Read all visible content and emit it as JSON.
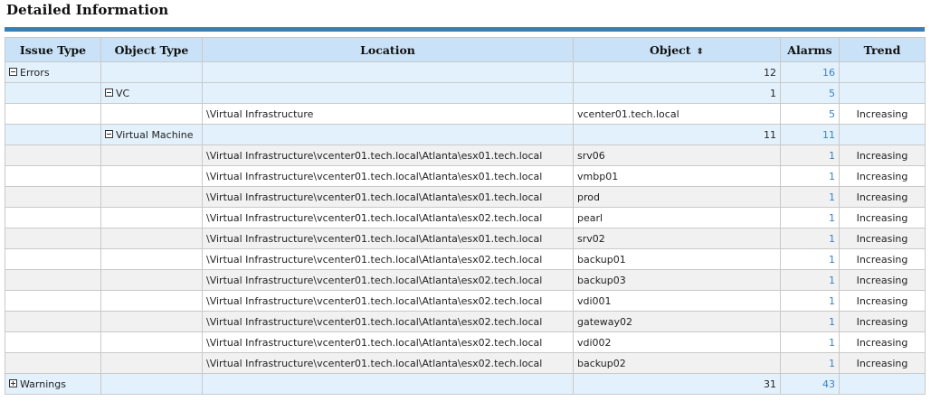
{
  "page_title": "Detailed Information",
  "columns": {
    "issue_type": "Issue Type",
    "object_type": "Object Type",
    "location": "Location",
    "object": "Object",
    "alarms": "Alarms",
    "trend": "Trend"
  },
  "sort_icon": "sort-up-down-icon",
  "colors": {
    "header_bg": "#c9e2f7",
    "group_bg": "#e3f1fc",
    "accent_bar": "#3a7fb0",
    "link": "#3a7fc8"
  },
  "errors_group": {
    "label": "Errors",
    "count": "12",
    "alarms": "16",
    "expanded": true
  },
  "vc_group": {
    "label": "VC",
    "count": "1",
    "alarms": "5",
    "expanded": true
  },
  "vc_rows": [
    {
      "location": "\\Virtual Infrastructure",
      "object": "vcenter01.tech.local",
      "alarms": "5",
      "trend": "Increasing"
    }
  ],
  "vm_group": {
    "label": "Virtual Machine",
    "count": "11",
    "alarms": "11",
    "expanded": true
  },
  "vm_rows": [
    {
      "location": "\\Virtual Infrastructure\\vcenter01.tech.local\\Atlanta\\esx01.tech.local",
      "object": "srv06",
      "alarms": "1",
      "trend": "Increasing"
    },
    {
      "location": "\\Virtual Infrastructure\\vcenter01.tech.local\\Atlanta\\esx01.tech.local",
      "object": "vmbp01",
      "alarms": "1",
      "trend": "Increasing"
    },
    {
      "location": "\\Virtual Infrastructure\\vcenter01.tech.local\\Atlanta\\esx01.tech.local",
      "object": "prod",
      "alarms": "1",
      "trend": "Increasing"
    },
    {
      "location": "\\Virtual Infrastructure\\vcenter01.tech.local\\Atlanta\\esx02.tech.local",
      "object": "pearl",
      "alarms": "1",
      "trend": "Increasing"
    },
    {
      "location": "\\Virtual Infrastructure\\vcenter01.tech.local\\Atlanta\\esx01.tech.local",
      "object": "srv02",
      "alarms": "1",
      "trend": "Increasing"
    },
    {
      "location": "\\Virtual Infrastructure\\vcenter01.tech.local\\Atlanta\\esx02.tech.local",
      "object": "backup01",
      "alarms": "1",
      "trend": "Increasing"
    },
    {
      "location": "\\Virtual Infrastructure\\vcenter01.tech.local\\Atlanta\\esx02.tech.local",
      "object": "backup03",
      "alarms": "1",
      "trend": "Increasing"
    },
    {
      "location": "\\Virtual Infrastructure\\vcenter01.tech.local\\Atlanta\\esx02.tech.local",
      "object": "vdi001",
      "alarms": "1",
      "trend": "Increasing"
    },
    {
      "location": "\\Virtual Infrastructure\\vcenter01.tech.local\\Atlanta\\esx02.tech.local",
      "object": "gateway02",
      "alarms": "1",
      "trend": "Increasing"
    },
    {
      "location": "\\Virtual Infrastructure\\vcenter01.tech.local\\Atlanta\\esx02.tech.local",
      "object": "vdi002",
      "alarms": "1",
      "trend": "Increasing"
    },
    {
      "location": "\\Virtual Infrastructure\\vcenter01.tech.local\\Atlanta\\esx02.tech.local",
      "object": "backup02",
      "alarms": "1",
      "trend": "Increasing"
    }
  ],
  "warnings_group": {
    "label": "Warnings",
    "count": "31",
    "alarms": "43",
    "expanded": false
  }
}
